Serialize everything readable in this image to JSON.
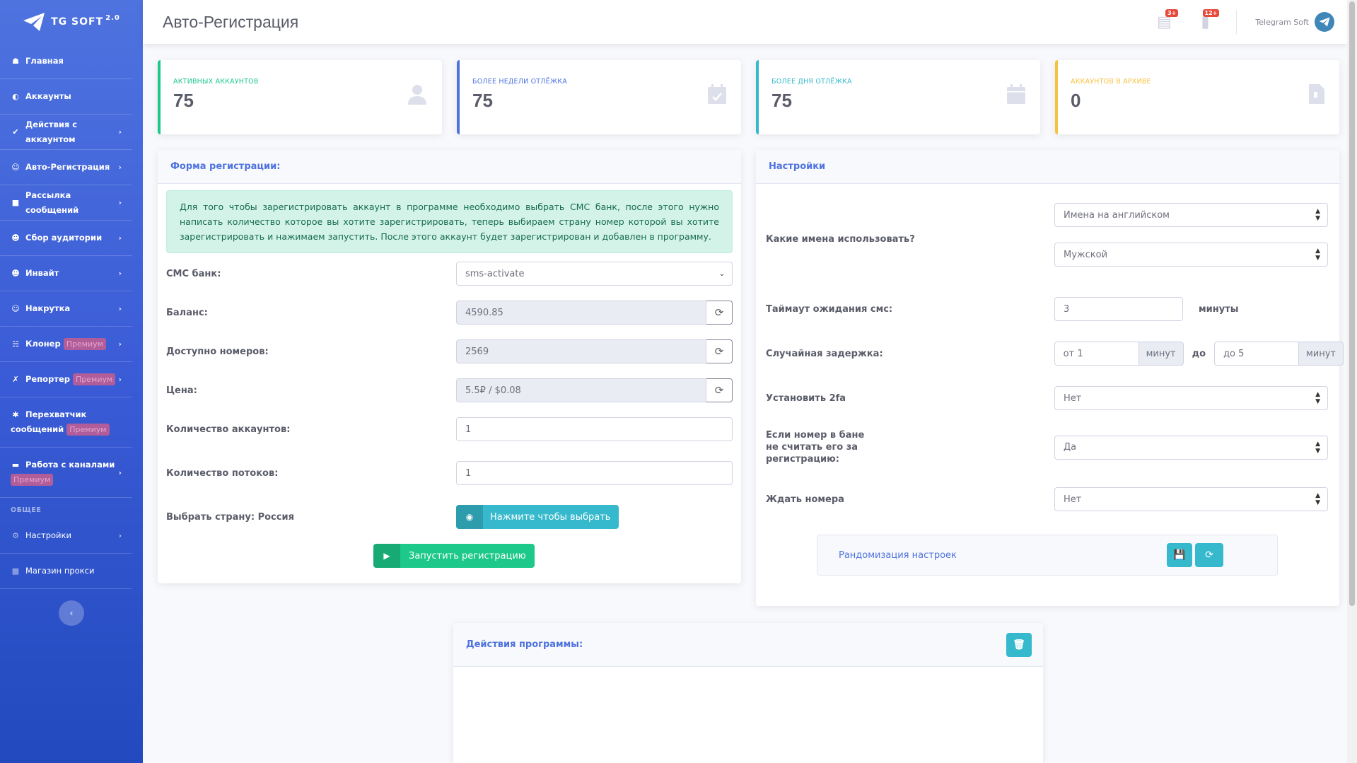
{
  "brand": {
    "name": "TG SOFT",
    "version": "2.0"
  },
  "sidebar": {
    "items": [
      {
        "label": "Главная",
        "icon": "tachometer-icon"
      },
      {
        "label": "Аккаунты",
        "icon": "gauge-icon"
      },
      {
        "label": "Действия с аккаунтом",
        "icon": "check-circle-icon"
      },
      {
        "label": "Авто-Регистрация",
        "icon": "user-plus-icon"
      },
      {
        "label": "Рассылка сообщений",
        "icon": "comment-icon"
      },
      {
        "label": "Сбор аудитории",
        "icon": "users-cog-icon"
      },
      {
        "label": "Инвайт",
        "icon": "users-icon"
      },
      {
        "label": "Накрутка",
        "icon": "user-clock-icon"
      },
      {
        "label": "Клонер",
        "icon": "sitemap-icon",
        "badge": "Премиум"
      },
      {
        "label": "Репортер",
        "icon": "user-slash-icon",
        "badge": "Премиум"
      },
      {
        "label": "Перехватчик сообщений",
        "icon": "asterisk-icon",
        "badge": "Премиум"
      },
      {
        "label": "Работа с каналами",
        "icon": "card-icon",
        "badge": "Премиум"
      }
    ],
    "section_heading": "ОБЩЕЕ",
    "general": [
      {
        "label": "Настройки",
        "icon": "cog-icon"
      },
      {
        "label": "Магазин прокси",
        "icon": "chart-icon"
      }
    ]
  },
  "topbar": {
    "title": "Авто-Регистрация",
    "alerts_badge": "3+",
    "messages_badge": "12+",
    "user_name": "Telegram Soft"
  },
  "stats": [
    {
      "label": "АКТИВНЫХ АККАУНТОВ",
      "value": "75",
      "color": "#1cc88a"
    },
    {
      "label": "БОЛЕЕ НЕДЕЛИ ОТЛЁЖКА",
      "value": "75",
      "color": "#4e73df"
    },
    {
      "label": "БОЛЕЕ ДНЯ ОТЛЁЖКА",
      "value": "75",
      "color": "#36b9cc"
    },
    {
      "label": "АККАУНТОВ В АРХИВЕ",
      "value": "0",
      "color": "#f6c23e"
    }
  ],
  "form": {
    "title": "Форма регистрации:",
    "info": "Для того чтобы зарегистрировать аккаунт в программе необходимо выбрать СМС банк, после этого нужно написать количество которое вы хотите зарегистрировать, теперь выбираем страну номер которой вы хотите зарегистрировать и нажимаем запустить. После этого аккаунт будет зарегистрирован и добавлен в программу.",
    "sms_bank_label": "СМС банк:",
    "sms_bank_value": "sms-activate",
    "balance_label": "Баланс:",
    "balance_value": "4590.85",
    "numbers_label": "Доступно номеров:",
    "numbers_value": "2569",
    "price_label": "Цена:",
    "price_value": "5.5₽ / $0.08",
    "accounts_label": "Количество аккаунтов:",
    "accounts_value": "1",
    "threads_label": "Количество потоков:",
    "threads_value": "1",
    "country_label": "Выбрать страну: Россия",
    "country_button": "Нажмите чтобы выбрать",
    "start_button": "Запустить регистрацию"
  },
  "settings": {
    "title": "Настройки",
    "names_label": "Какие имена использовать?",
    "names_lang": "Имена на английском",
    "names_gender": "Мужской",
    "timeout_label": "Таймаут ожидания смс:",
    "timeout_value": "3",
    "timeout_unit": "минуты",
    "delay_label": "Случайная задержка:",
    "delay_from": "от 1",
    "delay_to": "до 5",
    "delay_unit": "минут",
    "delay_sep": "до",
    "twofa_label": "Установить 2fa",
    "twofa_value": "Нет",
    "banned_label": "Если номер в бане не считать его за регистрацию:",
    "banned_value": "Да",
    "wait_label": "Ждать номера",
    "wait_value": "Нет",
    "randomize_label": "Рандомизация настроек"
  },
  "actions": {
    "title": "Действия программы:"
  }
}
